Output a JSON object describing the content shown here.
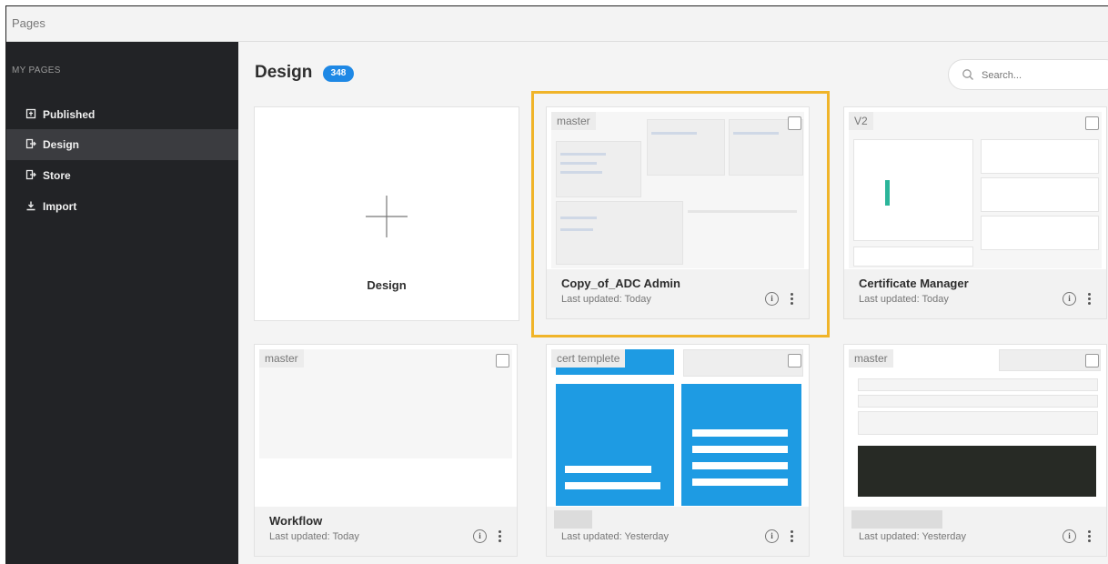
{
  "app": {
    "window_title": "Pages"
  },
  "sidebar": {
    "section_label": "MY PAGES",
    "items": [
      {
        "label": "Published",
        "icon": "published-icon",
        "active": false
      },
      {
        "label": "Design",
        "icon": "design-icon",
        "active": true
      },
      {
        "label": "Store",
        "icon": "store-icon",
        "active": false
      },
      {
        "label": "Import",
        "icon": "import-icon",
        "active": false
      }
    ]
  },
  "header": {
    "title": "Design",
    "count": "348"
  },
  "search": {
    "placeholder": "Search..."
  },
  "new_card": {
    "label": "Design"
  },
  "cards": [
    {
      "tag": "master",
      "name": "Copy_of_ADC Admin",
      "meta": "Last updated: Today",
      "selected": true
    },
    {
      "tag": "V2",
      "name": "Certificate Manager",
      "meta": "Last updated: Today",
      "selected": false
    },
    {
      "tag": "master",
      "name": "Workflow",
      "meta": "Last updated: Today",
      "selected": false
    },
    {
      "tag": "cert templete",
      "name": "",
      "meta": "Last updated: Yesterday",
      "selected": false
    },
    {
      "tag": "master",
      "name": "",
      "meta": "Last updated: Yesterday",
      "selected": false
    }
  ],
  "colors": {
    "accent": "#1e88e5",
    "selection": "#f0b429",
    "sidebar_bg": "#222326",
    "sidebar_active": "#3b3c40"
  }
}
